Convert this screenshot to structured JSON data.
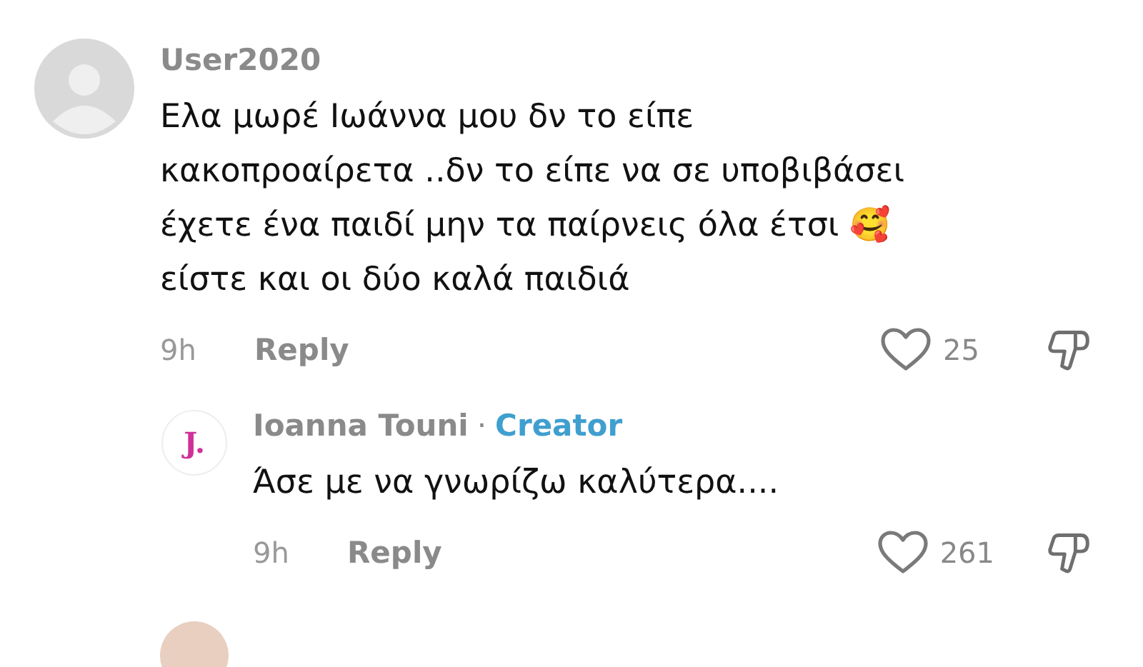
{
  "comments": [
    {
      "username": "User2020",
      "avatar": {
        "kind": "silhouette"
      },
      "text_lines": [
        "Ελα μωρέ Ιωάννα μου δν το είπε",
        "κακοπροαίρετα ..δν το είπε να σε υποβιβάσει",
        "έχετε ένα παιδί μην τα παίρνεις όλα έτσι 🥰",
        "είστε και οι δύο καλά παιδιά"
      ],
      "time": "9h",
      "reply": "Reply",
      "likes": "25",
      "replies": [
        {
          "username": "Ioanna Touni",
          "avatar": {
            "kind": "letter",
            "letter": "J."
          },
          "separator": "·",
          "creator_label": "Creator",
          "text_lines": [
            "Άσε με να γνωρίζω καλύτερα...."
          ],
          "time": "9h",
          "reply": "Reply",
          "likes": "261"
        }
      ]
    }
  ]
}
